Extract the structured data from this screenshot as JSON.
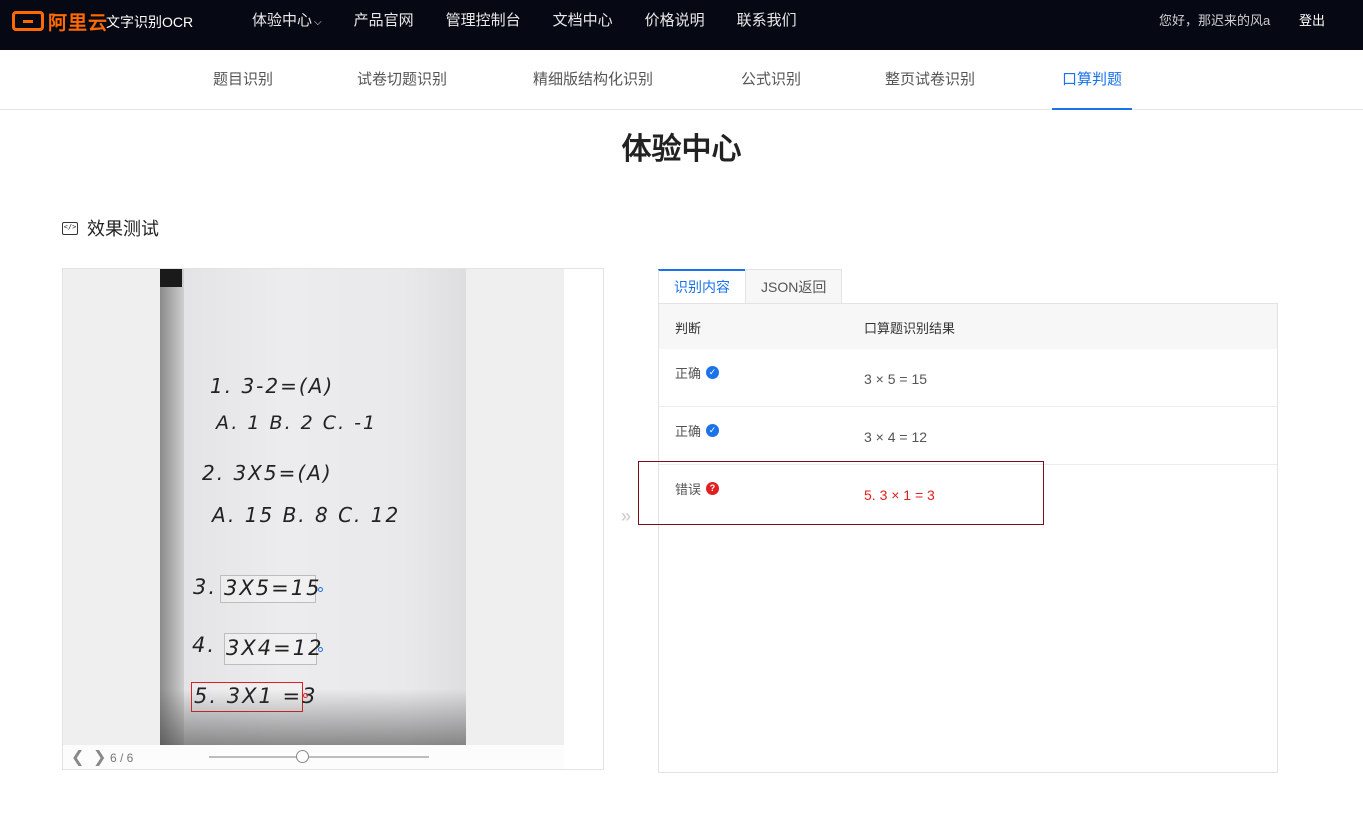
{
  "brand": {
    "logo_text": "阿里云",
    "product": "文字识别OCR",
    "accent": "#ff6a00"
  },
  "nav": {
    "items": [
      {
        "label": "体验中心",
        "has_dropdown": true
      },
      {
        "label": "产品官网"
      },
      {
        "label": "管理控制台"
      },
      {
        "label": "文档中心"
      },
      {
        "label": "价格说明"
      },
      {
        "label": "联系我们"
      }
    ],
    "greeting": "您好，那迟来的风a",
    "logout": "登出"
  },
  "subnav": {
    "tabs": [
      "题目识别",
      "试卷切题识别",
      "精细版结构化识别",
      "公式识别",
      "整页试卷识别",
      "口算判题"
    ],
    "active": "口算判题"
  },
  "page_title": "体验中心",
  "section_title": "效果测试",
  "viewer": {
    "page_indicator": "6 / 6",
    "handwriting": [
      "1. 3-2=(A)",
      "A. 1   B. 2   C. -1",
      "2. 3X5=(A)",
      "A. 15    B. 8    C. 12",
      "3.",
      "3X5=15",
      "4.",
      "3X4=12",
      "5. 3X1 =3"
    ]
  },
  "results": {
    "tabs": [
      "识别内容",
      "JSON返回"
    ],
    "active_tab": "识别内容",
    "columns": [
      "判断",
      "口算题识别结果"
    ],
    "rows": [
      {
        "judgement": "正确",
        "status": "correct",
        "expression": "3 × 5 = 15"
      },
      {
        "judgement": "正确",
        "status": "correct",
        "expression": "3 × 4 = 12"
      },
      {
        "judgement": "错误",
        "status": "wrong",
        "expression": "5. 3 × 1 = 3"
      }
    ]
  },
  "colors": {
    "primary": "#1a73e8",
    "error": "#e02020",
    "topbar": "#060814"
  }
}
